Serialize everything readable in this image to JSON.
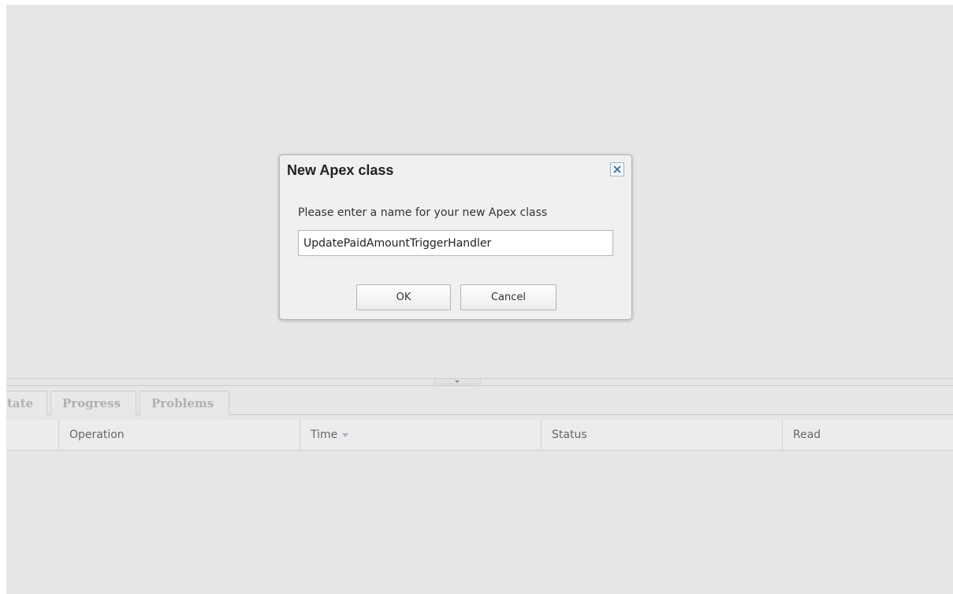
{
  "dialog": {
    "title": "New Apex class",
    "prompt": "Please enter a name for your new Apex class",
    "input_value": "UpdatePaidAmountTriggerHandler",
    "ok_label": "OK",
    "cancel_label": "Cancel",
    "close_icon": "close-icon"
  },
  "bottom_panel": {
    "tabs": [
      {
        "label": "tate"
      },
      {
        "label": "Progress"
      },
      {
        "label": "Problems"
      }
    ],
    "columns": [
      {
        "label": ""
      },
      {
        "label": "Operation"
      },
      {
        "label": "Time"
      },
      {
        "label": "Status"
      },
      {
        "label": "Read"
      }
    ],
    "sorted_column": "Time",
    "sort_icon": "sort-down-icon"
  }
}
